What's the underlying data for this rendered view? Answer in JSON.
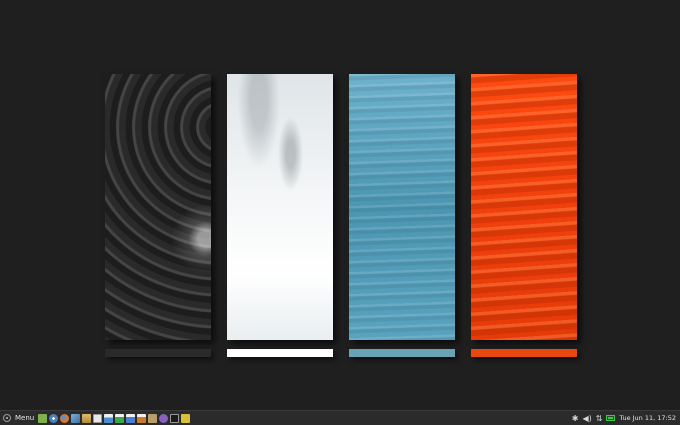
{
  "desktop": {
    "panels": [
      {
        "name": "dark-metal-structure",
        "color": "#2a2a2a"
      },
      {
        "name": "white-water-drops",
        "color": "#ffffff"
      },
      {
        "name": "blue-water-ripples",
        "color": "#6aa3b3"
      },
      {
        "name": "orange-sand-ripples",
        "color": "#e8480f"
      }
    ]
  },
  "taskbar": {
    "menu_label": "Menu",
    "launchers": [
      {
        "icon": "show-desktop-icon",
        "color": "#7fb04a"
      },
      {
        "icon": "chromium-icon",
        "color": "#4a7fc0"
      },
      {
        "icon": "firefox-icon",
        "color": "#e0782a"
      },
      {
        "icon": "image-viewer-icon",
        "color": "#5a8fbf"
      },
      {
        "icon": "file-manager-icon",
        "color": "#c9a24a"
      },
      {
        "icon": "text-editor-icon",
        "color": "#d8d8d8"
      },
      {
        "icon": "document-viewer-icon",
        "color": "#4a8fd0"
      },
      {
        "icon": "spreadsheet-icon",
        "color": "#3fa64a"
      },
      {
        "icon": "writer-icon",
        "color": "#4a7fd0"
      },
      {
        "icon": "presentation-icon",
        "color": "#cf7a2a"
      },
      {
        "icon": "archive-icon",
        "color": "#b89f6a"
      },
      {
        "icon": "software-manager-icon",
        "color": "#8a5fbf"
      },
      {
        "icon": "terminal-icon",
        "color": "#3a3a3a"
      },
      {
        "icon": "notes-icon",
        "color": "#d6c23a"
      }
    ],
    "tray": {
      "clock": "Tue Jun 11, 17:52"
    }
  }
}
